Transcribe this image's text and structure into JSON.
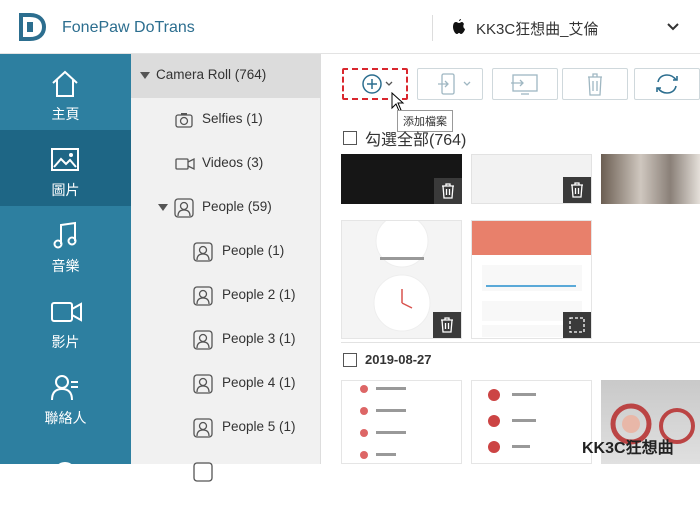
{
  "app": {
    "title": "FonePaw DoTrans"
  },
  "device": {
    "name": "KK3C狂想曲_艾倫"
  },
  "sidebar": {
    "items": [
      {
        "label": "主頁",
        "icon": "home-icon"
      },
      {
        "label": "圖片",
        "icon": "photo-icon",
        "active": true
      },
      {
        "label": "音樂",
        "icon": "music-icon"
      },
      {
        "label": "影片",
        "icon": "video-icon"
      },
      {
        "label": "聯絡人",
        "icon": "contacts-icon"
      }
    ]
  },
  "albums": {
    "items": [
      {
        "label": "Camera Roll (764)",
        "selected": true
      },
      {
        "label": "Selfies (1)"
      },
      {
        "label": "Videos (3)"
      },
      {
        "label": "People (59)"
      },
      {
        "label": "People (1)"
      },
      {
        "label": "People 2 (1)"
      },
      {
        "label": "People 3 (1)"
      },
      {
        "label": "People 4 (1)"
      },
      {
        "label": "People 5 (1)"
      }
    ]
  },
  "toolbar": {
    "tooltip": "添加檔案",
    "buttons": [
      "add-files-button",
      "export-to-device-button",
      "export-to-pc-button",
      "delete-button",
      "refresh-button"
    ]
  },
  "content": {
    "select_all_label": "勾選全部(764)",
    "group_date": "2019-08-27"
  },
  "colors": {
    "sidebar": "#2d7fa0",
    "sidebar_active": "#1e6685",
    "accent": "#2c6e8f",
    "highlight": "#d9272e"
  },
  "watermark": "KK3C狂想曲"
}
